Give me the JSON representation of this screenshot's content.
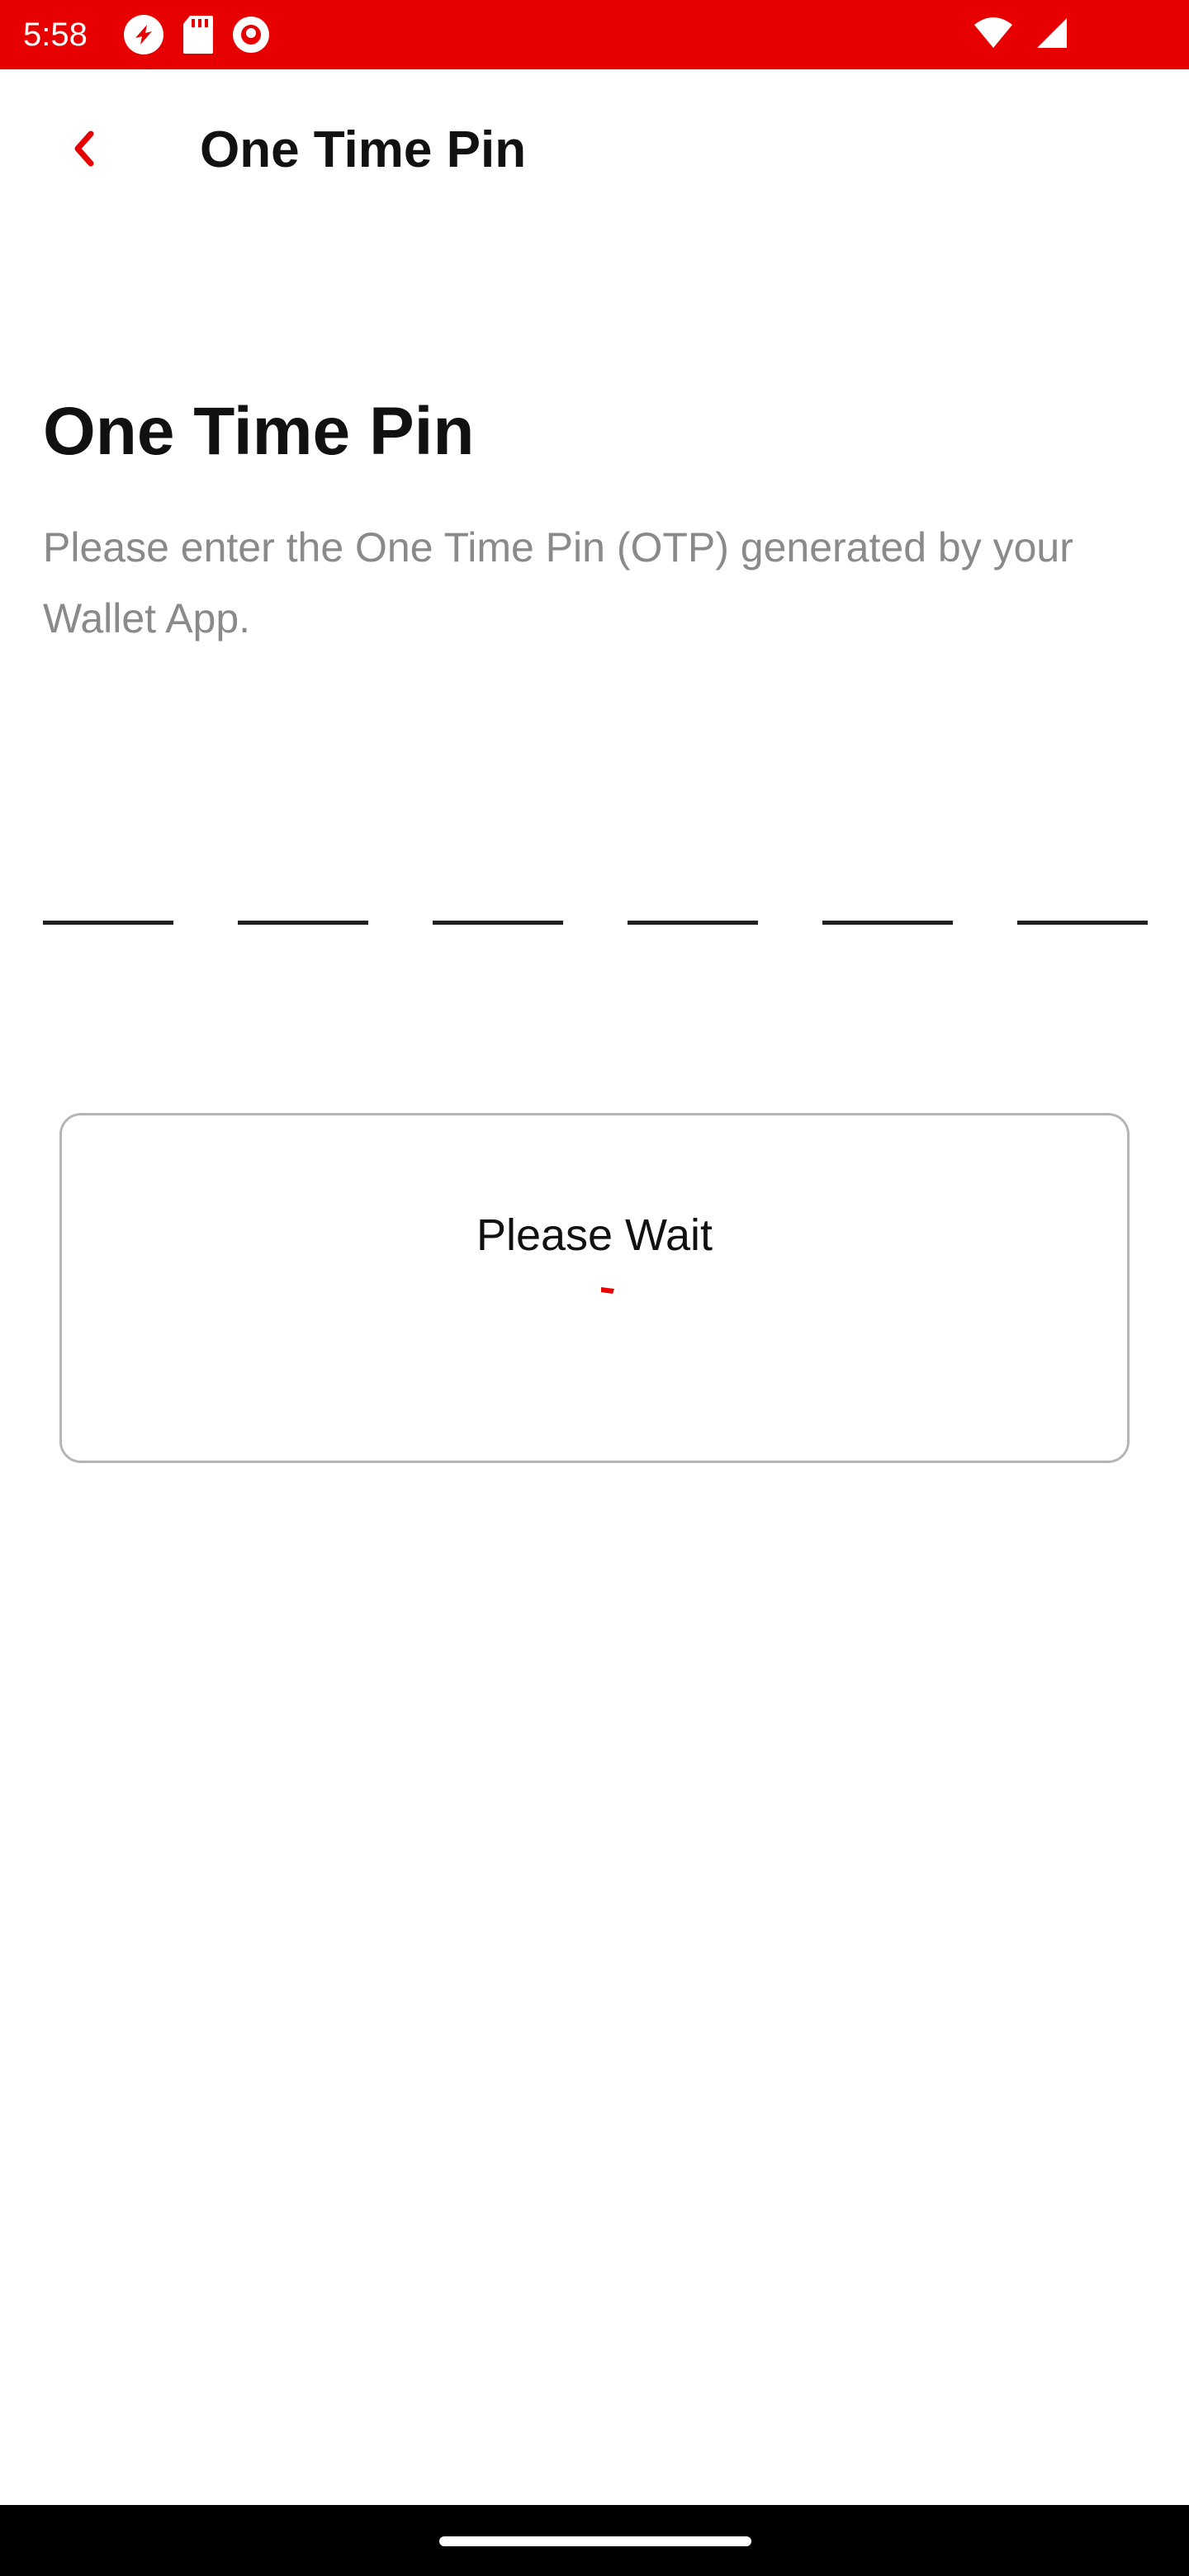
{
  "status_bar": {
    "time": "5:58",
    "background_color": "#e60000",
    "left_icons": [
      "sync-app-icon",
      "sd-card-icon",
      "app-notification-icon"
    ],
    "right_icons": [
      "wifi-icon",
      "cellular-signal-icon",
      "battery-icon"
    ]
  },
  "app_bar": {
    "title": "One Time Pin",
    "back_icon": "chevron-left-icon",
    "accent_color": "#e60000"
  },
  "main": {
    "heading": "One Time Pin",
    "description": "Please enter the One Time Pin (OTP) generated by your Wallet App.",
    "otp": {
      "length": 6,
      "values": [
        "",
        "",
        "",
        "",
        "",
        ""
      ]
    }
  },
  "dialog": {
    "message": "Please Wait",
    "spinner_color": "#e60000"
  }
}
